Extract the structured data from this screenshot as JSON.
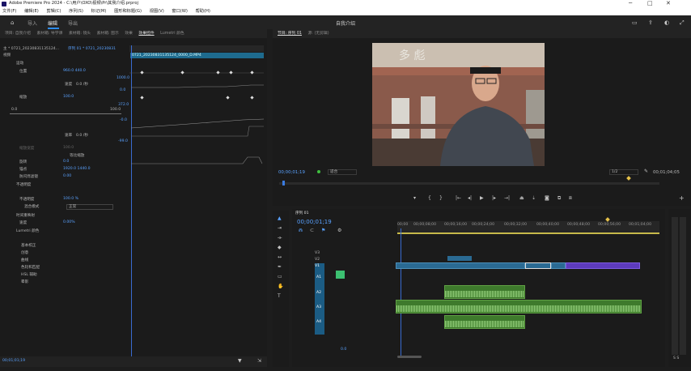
{
  "window": {
    "title": "Adobe Premiere Pro 2024 - C:\\用户\\OXO\\视频\\Pr\\其我介绍.prproj",
    "controls": [
      "─",
      "□",
      "✕"
    ]
  },
  "menu": [
    "文件(F)",
    "编辑(E)",
    "剪辑(C)",
    "序列(S)",
    "标记(M)",
    "图形和标题(G)",
    "视图(V)",
    "窗口(W)",
    "帮助(H)"
  ],
  "workspace": {
    "tabs": [
      "导入",
      "编辑",
      "导出"
    ],
    "active": "编辑",
    "center_title": "自我介绍"
  },
  "effect_controls": {
    "tabs": [
      "项目: 自我介绍",
      "素材箱: 导学课",
      "素材箱: 镜头",
      "素材箱: 图示",
      "效果",
      "效果控件",
      "Lumetri 颜色"
    ],
    "active_tab": "效果控件",
    "source_label": "主 * 0721_20230831135124...",
    "sequence_label": "序列 01 * 0721_20230831",
    "clip_name": "0721_20230831135124_0000_D.MP4",
    "video_header": "视频",
    "rows": [
      {
        "name": "运动",
        "value": ""
      },
      {
        "name": "位置",
        "value": "960.0   440.0"
      },
      {
        "name": "速度",
        "value": "0.0 /秒"
      },
      {
        "name": "缩放",
        "value": "100.0"
      },
      {
        "name": "速率",
        "value": "0.0 /秒"
      },
      {
        "name": "缩放宽度",
        "value": "100.0"
      },
      {
        "name": "等比缩放",
        "value": ""
      },
      {
        "name": "旋转",
        "value": "0.0"
      },
      {
        "name": "锚点",
        "value": "1920.0   1440.0"
      },
      {
        "name": "防闪烁滤镜",
        "value": "0.00"
      },
      {
        "name": "不透明度",
        "value": ""
      },
      {
        "name": "不透明度",
        "value": "100.0 %"
      },
      {
        "name": "混合模式",
        "value": "正常"
      },
      {
        "name": "时间重映射",
        "value": ""
      },
      {
        "name": "速度",
        "value": "0.00%"
      },
      {
        "name": "Lumetri 颜色",
        "value": ""
      },
      {
        "name": "基本校正",
        "value": ""
      },
      {
        "name": "创意",
        "value": ""
      },
      {
        "name": "曲线",
        "value": ""
      },
      {
        "name": "色轮和匹配",
        "value": ""
      },
      {
        "name": "HSL 辅助",
        "value": ""
      },
      {
        "name": "晕影",
        "value": ""
      }
    ],
    "graph_values": {
      "top": "1000.0",
      "mid": "0.0",
      "scale_top": "372.0",
      "scale_low": "100.0",
      "num_a": "0.0",
      "num_b": "-0.0",
      "num_c": "-99.0"
    },
    "timecode": "00;01;01;19"
  },
  "program": {
    "tabs": [
      "节目: 序列 01",
      "源: (无剪辑)"
    ],
    "timecode": "00;00;01;19",
    "fit": "适合",
    "quality": "1/2",
    "duration": "00;01;04;05"
  },
  "timeline": {
    "tab": "序列 01",
    "timecode": "00;00;01;19",
    "ruler": [
      "00;00",
      "00;00;08;00",
      "00;00;16;00",
      "00;00;24;00",
      "00;00;32;00",
      "00;00;40;00",
      "00;00;48;00",
      "00;00;56;00",
      "00;01;04;00"
    ],
    "video_tracks": [
      "V3",
      "V2",
      "V1"
    ],
    "audio_tracks": [
      "A1",
      "A2",
      "A3",
      "A4"
    ],
    "mix_value": "0.0"
  },
  "meter": {
    "label": "S S"
  }
}
